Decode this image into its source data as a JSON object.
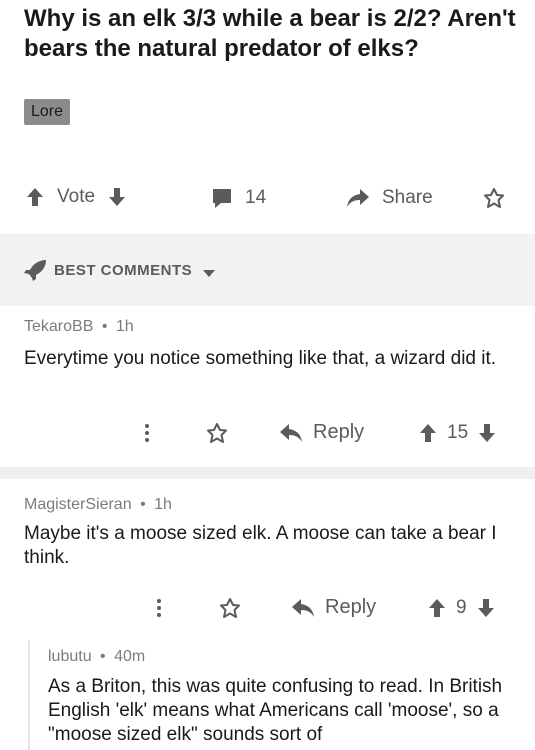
{
  "post": {
    "title": "Why is an elk 3/3 while a bear is 2/2? Aren't bears the natural predator of elks?",
    "flair": "Lore",
    "vote_label": "Vote",
    "comment_count": "14",
    "share_label": "Share"
  },
  "sort": {
    "label": "BEST COMMENTS"
  },
  "comments": [
    {
      "author": "TekaroBB",
      "age": "1h",
      "text": "Everytime you notice something like that, a wizard did it.",
      "reply_label": "Reply",
      "score": "15"
    },
    {
      "author": "MagisterSieran",
      "age": "1h",
      "text": "Maybe it's a moose sized elk. A moose can take a bear I think.",
      "reply_label": "Reply",
      "score": "9"
    },
    {
      "author": "lubutu",
      "age": "40m",
      "text": "As a Briton, this was quite confusing to read. In British English 'elk' means what Americans call 'moose', so a \"moose sized elk\" sounds sort of"
    }
  ],
  "separator": "•",
  "colors": {
    "text": "#1a1a1b",
    "muted": "#5b5b5b",
    "meta": "#7c7c7c",
    "flair_bg": "#8c8c8c",
    "band_bg": "#f2f2f2"
  },
  "icons": [
    "upvote-icon",
    "downvote-icon",
    "comment-icon",
    "share-icon",
    "save-icon",
    "rocket-icon",
    "chevron-down-icon",
    "more-icon",
    "reply-icon"
  ]
}
